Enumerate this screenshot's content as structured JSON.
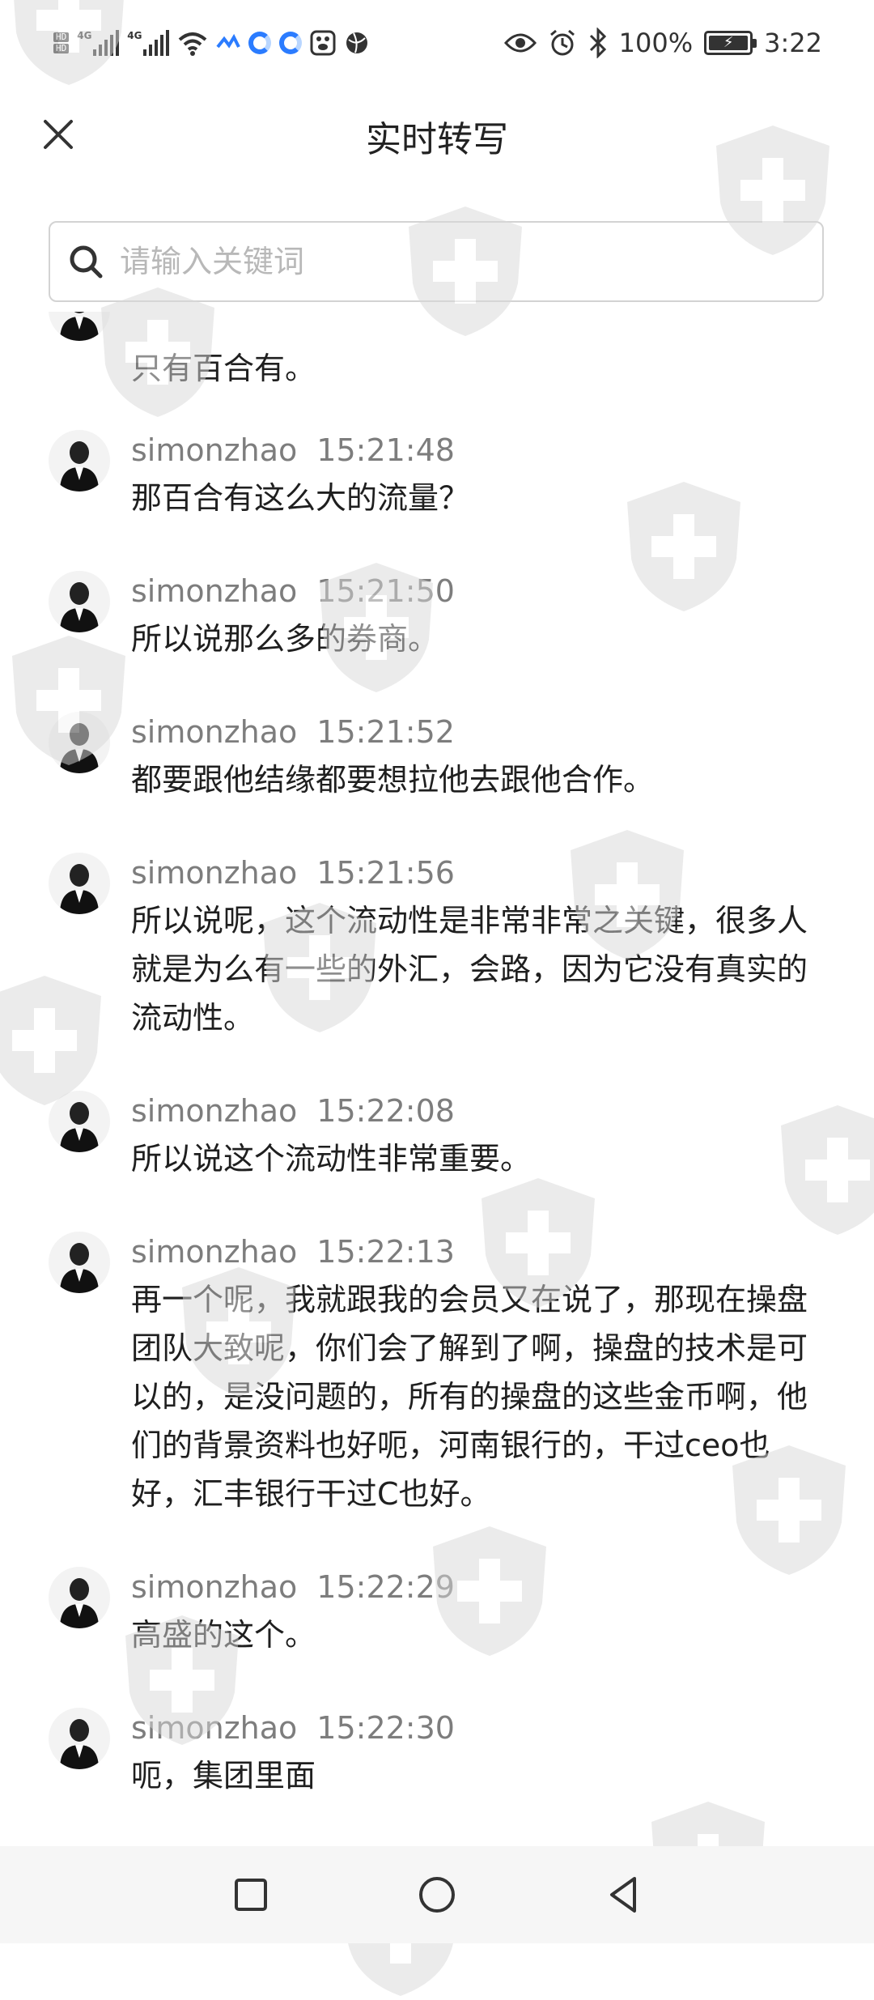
{
  "status_bar": {
    "hd_top": "HD",
    "hd_bottom": "HD",
    "signal1_tag": "4G",
    "signal2_tag": "4G",
    "battery_percent": "100%",
    "time": "3:22"
  },
  "header": {
    "title": "实时转写"
  },
  "search": {
    "placeholder": "请输入关键词",
    "value": ""
  },
  "messages": [
    {
      "name": "",
      "time": "",
      "text": "只有百合有。"
    },
    {
      "name": "simonzhao",
      "time": "15:21:48",
      "text": "那百合有这么大的流量？"
    },
    {
      "name": "simonzhao",
      "time": "15:21:50",
      "text": "所以说那么多的券商。"
    },
    {
      "name": "simonzhao",
      "time": "15:21:52",
      "text": "都要跟他结缘都要想拉他去跟他合作。"
    },
    {
      "name": "simonzhao",
      "time": "15:21:56",
      "text": "所以说呢，这个流动性是非常非常之关键，很多人就是为么有一些的外汇，会路，因为它没有真实的流动性。"
    },
    {
      "name": "simonzhao",
      "time": "15:22:08",
      "text": "所以说这个流动性非常重要。"
    },
    {
      "name": "simonzhao",
      "time": "15:22:13",
      "text": "再一个呢，我就跟我的会员又在说了，那现在操盘团队大致呢，你们会了解到了啊，操盘的技术是可以的，是没问题的，所有的操盘的这些金币啊，他们的背景资料也好呃，河南银行的，干过ceo也好，汇丰银行干过C也好。"
    },
    {
      "name": "simonzhao",
      "time": "15:22:29",
      "text": "高盛的这个。"
    },
    {
      "name": "simonzhao",
      "time": "15:22:30",
      "text": "呃，集团里面"
    }
  ],
  "nav_bar": {
    "icons": [
      "recents-square-icon",
      "home-circle-icon",
      "back-triangle-icon"
    ]
  },
  "colors": {
    "name_gray": "#7d7d7d",
    "text_dark": "#1f1f1f",
    "watermark": "#e6e6e6"
  }
}
